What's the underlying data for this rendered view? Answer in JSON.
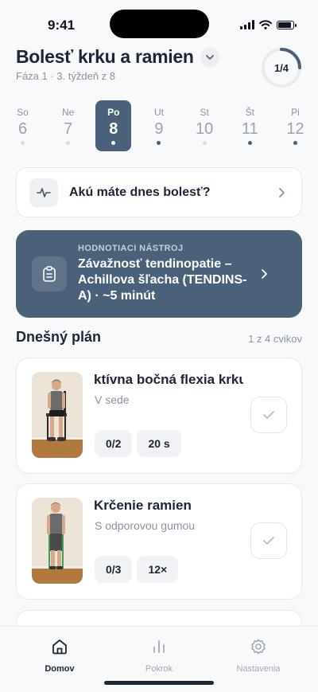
{
  "status_bar": {
    "time": "9:41"
  },
  "header": {
    "title": "Bolesť krku a ramien",
    "subtitle": "Fáza 1 · 3. týždeň z 8",
    "progress_label": "1/4",
    "progress_fraction": 0.25
  },
  "week": [
    {
      "name": "So",
      "date": "6",
      "dot": "empty",
      "active": false
    },
    {
      "name": "Ne",
      "date": "7",
      "dot": "empty",
      "active": false
    },
    {
      "name": "Po",
      "date": "8",
      "dot": "filled",
      "active": true
    },
    {
      "name": "Ut",
      "date": "9",
      "dot": "filled",
      "active": false
    },
    {
      "name": "St",
      "date": "10",
      "dot": "empty",
      "active": false
    },
    {
      "name": "Št",
      "date": "11",
      "dot": "filled",
      "active": false
    },
    {
      "name": "Pi",
      "date": "12",
      "dot": "filled",
      "active": false
    }
  ],
  "pain_card": {
    "label": "Akú máte dnes bolesť?"
  },
  "assessment_card": {
    "tag": "HODNOTIACI NÁSTROJ",
    "title": "Závažnosť tendinopatie – Achillova šľacha (TENDINS-A) · ~5 minút"
  },
  "plan": {
    "title": "Dnešný plán",
    "count": "1 z 4 cvikov",
    "exercises": [
      {
        "name": "ktívna bočná flexia krku",
        "subtitle": "V sede",
        "sets": "0/2",
        "dose": "20 s"
      },
      {
        "name": "Krčenie ramien",
        "subtitle": "S odporovou gumou",
        "sets": "0/3",
        "dose": "12×"
      }
    ]
  },
  "tabbar": {
    "items": [
      {
        "label": "Domov",
        "icon": "home-icon",
        "active": true
      },
      {
        "label": "Pokrok",
        "icon": "bar-chart-icon",
        "active": false
      },
      {
        "label": "Nastavenia",
        "icon": "gear-icon",
        "active": false
      }
    ]
  },
  "colors": {
    "accent": "#4b6079",
    "text": "#1c2637",
    "muted": "#8a93a3",
    "background": "#f8f9fb"
  }
}
